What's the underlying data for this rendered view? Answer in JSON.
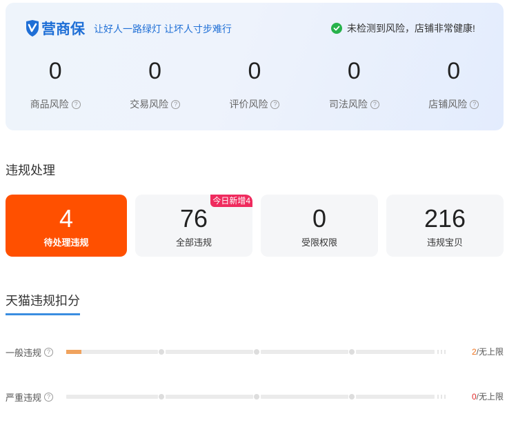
{
  "banner": {
    "logo_text": "营商保",
    "slogan": "让好人一路绿灯 让坏人寸步难行",
    "status_text": "未检测到风险，店铺非常健康!",
    "risks": [
      {
        "value": "0",
        "label": "商品风险"
      },
      {
        "value": "0",
        "label": "交易风险"
      },
      {
        "value": "0",
        "label": "评价风险"
      },
      {
        "value": "0",
        "label": "司法风险"
      },
      {
        "value": "0",
        "label": "店铺风险"
      }
    ]
  },
  "violations": {
    "title": "违规处理",
    "cards": [
      {
        "value": "4",
        "label": "待处理违规"
      },
      {
        "value": "76",
        "label": "全部违规",
        "badge": "今日新增4"
      },
      {
        "value": "0",
        "label": "受限权限"
      },
      {
        "value": "216",
        "label": "违规宝贝"
      }
    ]
  },
  "tmall": {
    "title": "天猫违规扣分",
    "rows": [
      {
        "label": "一般违规",
        "current": "2",
        "limit_text": "/无上限",
        "progress_fraction": 0.04
      },
      {
        "label": "严重违规",
        "current": "0",
        "limit_text": "/无上限",
        "progress_fraction": 0
      }
    ]
  },
  "colors": {
    "brand_blue": "#1f6fd6",
    "active_orange": "#ff5000",
    "badge_pink": "#ef2b5e",
    "status_green": "#27b24b",
    "progress_orange": "#f0a35e"
  }
}
